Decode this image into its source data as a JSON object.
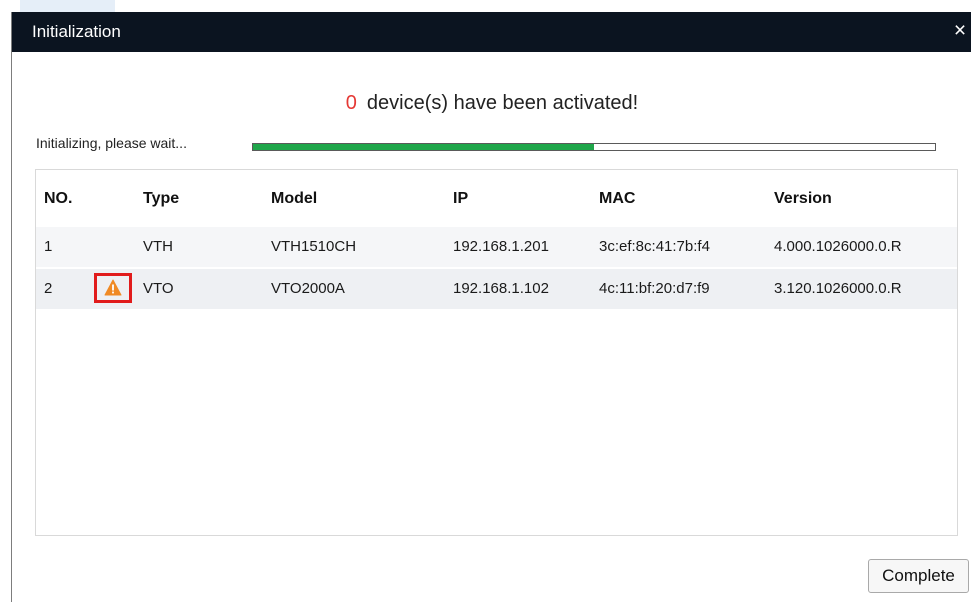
{
  "dialog": {
    "title": "Initialization",
    "close_glyph": "×"
  },
  "activation": {
    "count": "0",
    "message": "device(s) have been activated!"
  },
  "progress": {
    "label": "Initializing, please wait...",
    "fraction": 0.5
  },
  "table": {
    "headers": [
      "NO.",
      "Type",
      "Model",
      "IP",
      "MAC",
      "Version"
    ],
    "rows": [
      {
        "no": "1",
        "type": "VTH",
        "model": "VTH1510CH",
        "ip": "192.168.1.201",
        "mac": "3c:ef:8c:41:7b:f4",
        "version": "4.000.1026000.0.R",
        "warning": false
      },
      {
        "no": "2",
        "type": "VTO",
        "model": "VTO2000A",
        "ip": "192.168.1.102",
        "mac": "4c:11:bf:20:d7:f9",
        "version": "3.120.1026000.0.R",
        "warning": true
      }
    ]
  },
  "footer": {
    "complete_label": "Complete"
  },
  "icons": {
    "warning": "warning-triangle-icon",
    "close": "close-icon"
  },
  "colors": {
    "titlebar": "#0b1420",
    "count_text": "#e53935",
    "progress_fill": "#1fa64a",
    "warning_icon": "#f08a24",
    "highlight_box": "#e11b1b"
  }
}
